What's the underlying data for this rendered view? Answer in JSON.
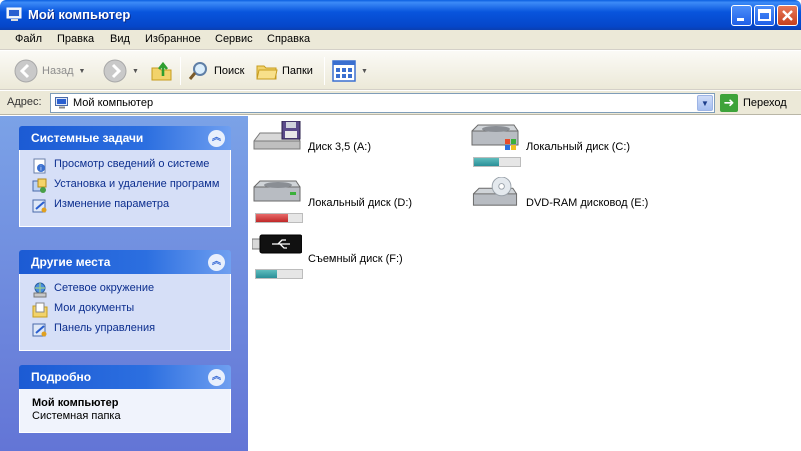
{
  "window": {
    "title": "Мой компьютер"
  },
  "menu": [
    "Файл",
    "Правка",
    "Вид",
    "Избранное",
    "Сервис",
    "Справка"
  ],
  "toolbar": {
    "back": "Назад",
    "search": "Поиск",
    "folders": "Папки"
  },
  "address": {
    "label": "Адрес:",
    "value": "Мой компьютер",
    "go": "Переход"
  },
  "panels": {
    "system_tasks": {
      "title": "Системные задачи",
      "items": [
        {
          "label": "Просмотр сведений о системе",
          "icon": "system-info-icon"
        },
        {
          "label": "Установка и удаление программ",
          "icon": "add-remove-programs-icon"
        },
        {
          "label": "Изменение параметра",
          "icon": "control-panel-icon"
        }
      ]
    },
    "other_places": {
      "title": "Другие места",
      "items": [
        {
          "label": "Сетевое окружение",
          "icon": "network-places-icon"
        },
        {
          "label": "Мои документы",
          "icon": "my-documents-icon"
        },
        {
          "label": "Панель управления",
          "icon": "control-panel-icon"
        }
      ]
    },
    "details": {
      "title": "Подробно",
      "name": "Мой компьютер",
      "type": "Системная папка"
    }
  },
  "drives": [
    {
      "name": "Диск 3,5 (A:)",
      "icon": "floppy-drive-icon",
      "used_fraction": null
    },
    {
      "name": "Локальный диск (C:)",
      "icon": "system-drive-icon",
      "used_fraction": 0.55
    },
    {
      "name": "Локальный диск (D:)",
      "icon": "hard-drive-icon",
      "used_fraction": 0.7
    },
    {
      "name": "DVD-RAM дисковод (E:)",
      "icon": "dvd-drive-icon",
      "used_fraction": null
    },
    {
      "name": "Съемный диск (F:)",
      "icon": "usb-drive-icon",
      "used_fraction": 0.45
    }
  ],
  "colors": {
    "titlebar": "#0855dd",
    "taskpane": "#7ba2e7",
    "usage_fill": "#2a8f98",
    "usage_fill_critical": "#c02828"
  }
}
